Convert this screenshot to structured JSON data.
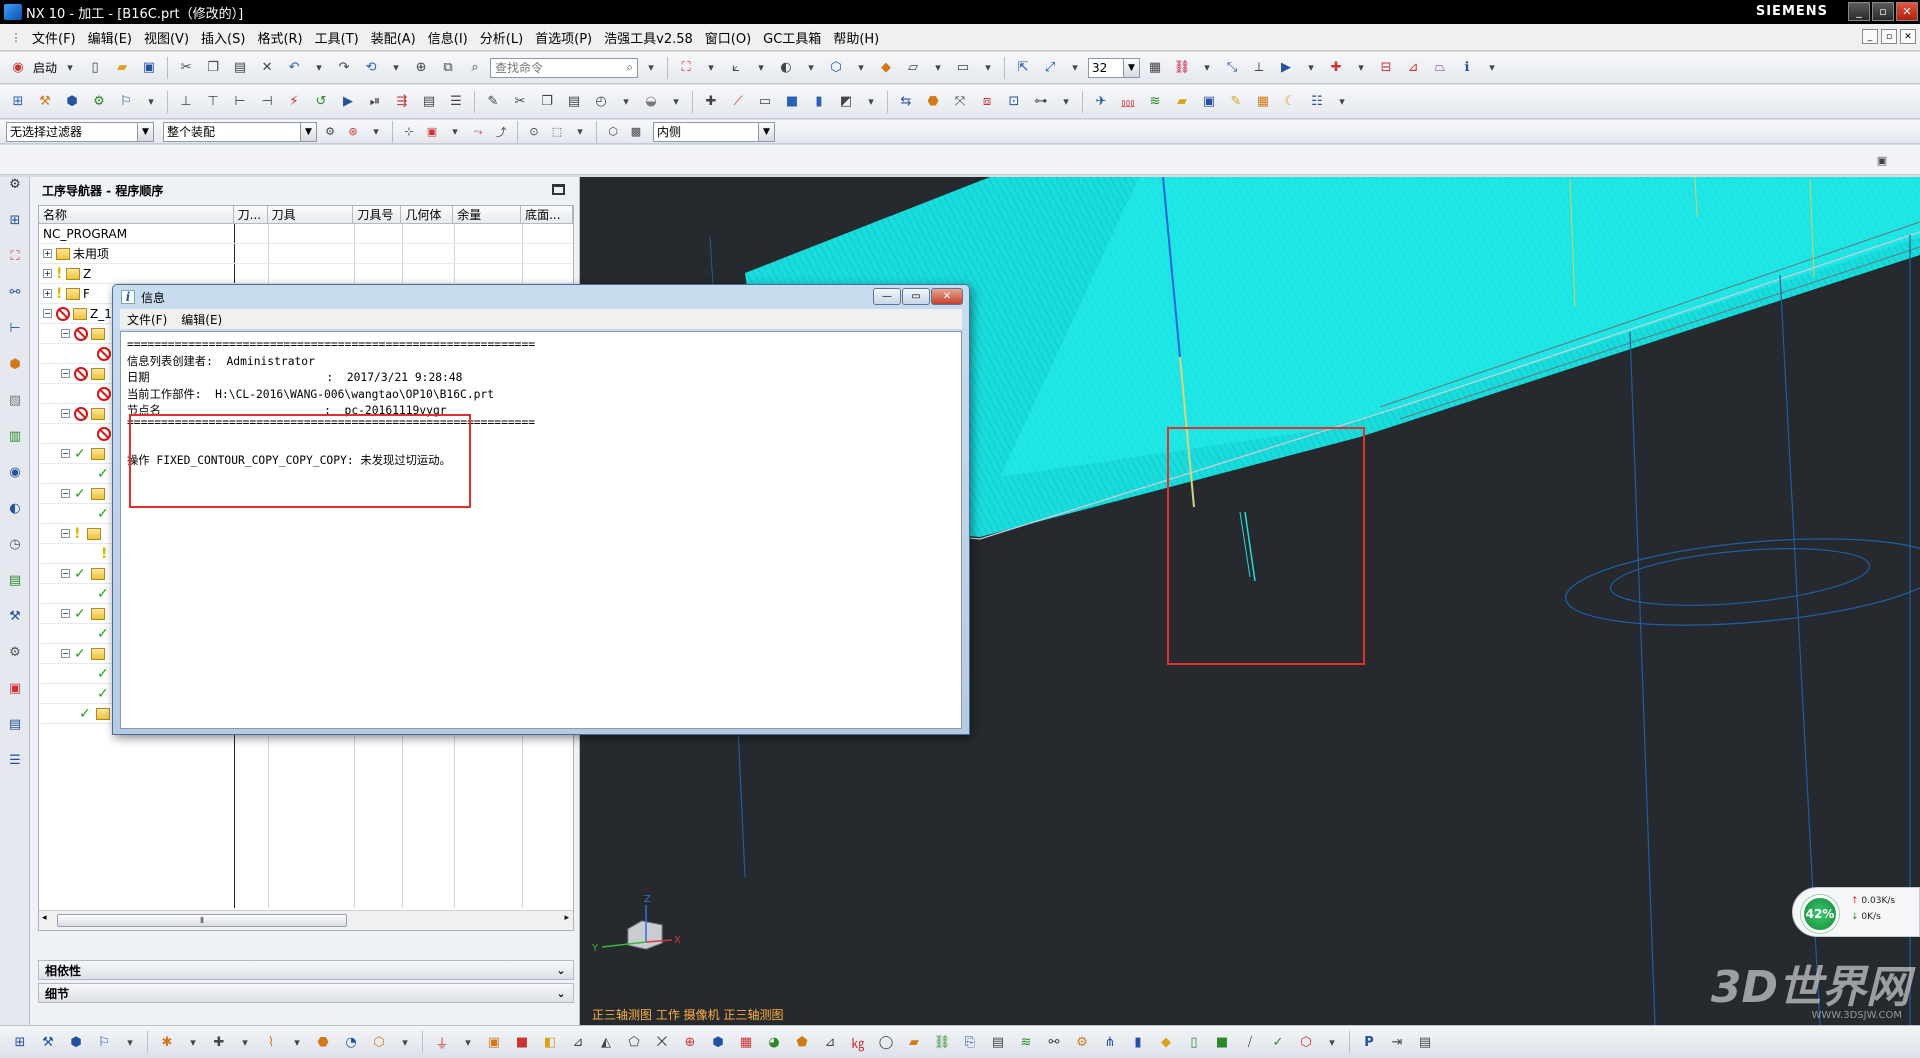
{
  "window": {
    "title": "NX 10 - 加工 - [B16C.prt（修改的）]",
    "brand": "SIEMENS",
    "controls": [
      "_",
      "▫",
      "✕"
    ]
  },
  "menu": [
    "文件(F)",
    "编辑(E)",
    "视图(V)",
    "插入(S)",
    "格式(R)",
    "工具(T)",
    "装配(A)",
    "信息(I)",
    "分析(L)",
    "首选项(P)",
    "浩强工具v2.58",
    "窗口(O)",
    "GC工具箱",
    "帮助(H)"
  ],
  "toolbar": {
    "start_label": "启动",
    "search_placeholder": "查找命令",
    "zoom_value": "32"
  },
  "filters": {
    "selection_filter": "无选择过滤器",
    "assembly_scope": "整个装配",
    "inside_option": "内侧"
  },
  "navigator": {
    "title": "工序导航器 - 程序顺序",
    "columns": [
      "名称",
      "刀...",
      "刀具",
      "刀具号",
      "几何体",
      "余量",
      "底面..."
    ],
    "rows": [
      {
        "name": "NC_PROGRAM",
        "status": "none",
        "expand": ""
      },
      {
        "name": "未用项",
        "status": "none",
        "expand": "+"
      },
      {
        "name": "Z",
        "status": "warn",
        "expand": "+"
      },
      {
        "name": "F",
        "status": "warn",
        "expand": "+"
      },
      {
        "name": "Z_1",
        "status": "no",
        "expand": "−"
      }
    ],
    "panels": [
      "相依性",
      "细节"
    ]
  },
  "info_dialog": {
    "title": "信息",
    "menu": [
      "文件(F)",
      "编辑(E)"
    ],
    "lines": [
      "============================================================",
      "信息列表创建者:  Administrator",
      "日期                          :  2017/3/21 9:28:48",
      "当前工作部件:  H:\\CL-2016\\WANG-006\\wangtao\\OP10\\B16C.prt",
      "节点名                        :  pc-20161119vygr",
      "============================================================",
      "",
      "操作 FIXED_CONTOUR_COPY_COPY_COPY: 未发现过切运动。"
    ]
  },
  "viewport": {
    "status_text": "正三轴测图 工作 摄像机 正三轴测图",
    "cpu_percent": "42%",
    "net_up": "0.03K/s",
    "net_down": "0K/s",
    "watermark": "3D世界网",
    "watermark_sub": "WWW.3DSJW.COM"
  },
  "colors": {
    "viewport_bg": "#26292e",
    "surface": "#1ce6e6",
    "highlight_box": "#e0312c"
  }
}
